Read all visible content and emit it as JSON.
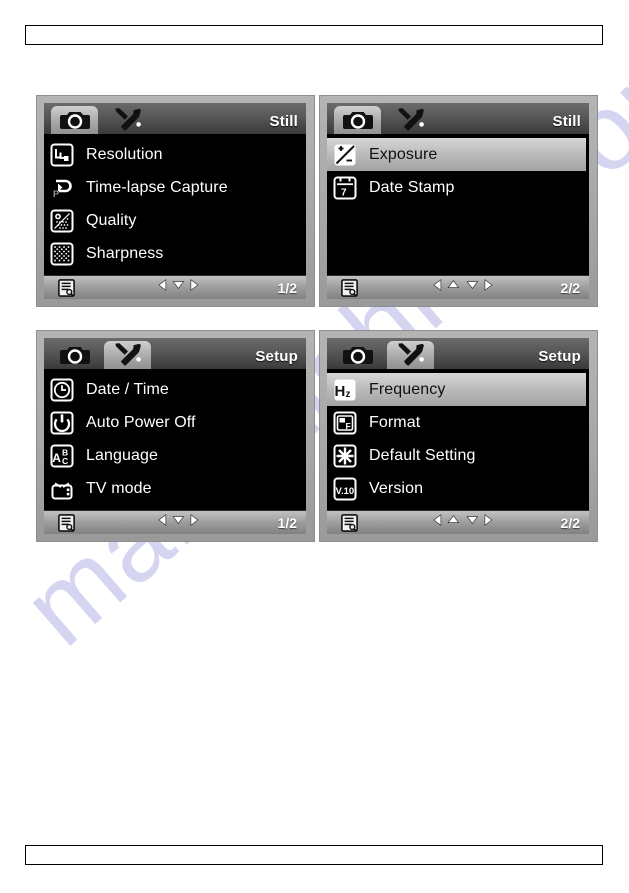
{
  "watermark": {
    "text": "manualshive.com"
  },
  "header_bar": {
    "text": ""
  },
  "footer_bar": {
    "text": ""
  },
  "colors": {
    "lcd_background": "#000000",
    "bezel": "#a8a8a8",
    "tabbar": "#575757",
    "selected_row": "#c0c0c0",
    "text": "#ffffff",
    "selected_text": "#111111"
  },
  "screens": [
    {
      "id": "still-page-1",
      "mode_label": "Still",
      "tabs": [
        {
          "name": "camera-tab",
          "icon": "camera-icon",
          "active": true
        },
        {
          "name": "setup-tab",
          "icon": "tools-icon",
          "active": false
        }
      ],
      "items": [
        {
          "label": "Resolution",
          "icon": "resolution-icon",
          "selected": false
        },
        {
          "label": "Time-lapse Capture",
          "icon": "time-lapse-icon",
          "selected": false
        },
        {
          "label": "Quality",
          "icon": "quality-icon",
          "selected": false
        },
        {
          "label": "Sharpness",
          "icon": "sharpness-icon",
          "selected": false
        }
      ],
      "status": {
        "menu_icon": "menu-list-icon",
        "arrows": [
          "left",
          "down",
          "right"
        ],
        "page": "1/2"
      }
    },
    {
      "id": "still-page-2",
      "mode_label": "Still",
      "tabs": [
        {
          "name": "camera-tab",
          "icon": "camera-icon",
          "active": true
        },
        {
          "name": "setup-tab",
          "icon": "tools-icon",
          "active": false
        }
      ],
      "items": [
        {
          "label": "Exposure",
          "icon": "exposure-icon",
          "selected": true
        },
        {
          "label": "Date Stamp",
          "icon": "date-stamp-icon",
          "selected": false
        }
      ],
      "status": {
        "menu_icon": "menu-list-icon",
        "arrows": [
          "left",
          "up",
          "down",
          "right"
        ],
        "page": "2/2"
      }
    },
    {
      "id": "setup-page-1",
      "mode_label": "Setup",
      "tabs": [
        {
          "name": "camera-tab",
          "icon": "camera-icon",
          "active": false
        },
        {
          "name": "setup-tab",
          "icon": "tools-icon",
          "active": true
        }
      ],
      "items": [
        {
          "label": "Date / Time",
          "icon": "clock-icon",
          "selected": false
        },
        {
          "label": "Auto Power Off",
          "icon": "power-icon",
          "selected": false
        },
        {
          "label": "Language",
          "icon": "abc-icon",
          "selected": false
        },
        {
          "label": "TV mode",
          "icon": "tv-icon",
          "selected": false
        }
      ],
      "status": {
        "menu_icon": "menu-list-icon",
        "arrows": [
          "left",
          "down",
          "right"
        ],
        "page": "1/2"
      }
    },
    {
      "id": "setup-page-2",
      "mode_label": "Setup",
      "tabs": [
        {
          "name": "camera-tab",
          "icon": "camera-icon",
          "active": false
        },
        {
          "name": "setup-tab",
          "icon": "tools-icon",
          "active": true
        }
      ],
      "items": [
        {
          "label": "Frequency",
          "icon": "hz-icon",
          "selected": true
        },
        {
          "label": "Format",
          "icon": "format-icon",
          "selected": false
        },
        {
          "label": "Default Setting",
          "icon": "snowflake-icon",
          "selected": false
        },
        {
          "label": "Version",
          "icon": "version-icon",
          "selected": false
        }
      ],
      "status": {
        "menu_icon": "menu-list-icon",
        "arrows": [
          "left",
          "up",
          "down",
          "right"
        ],
        "page": "2/2"
      }
    }
  ]
}
